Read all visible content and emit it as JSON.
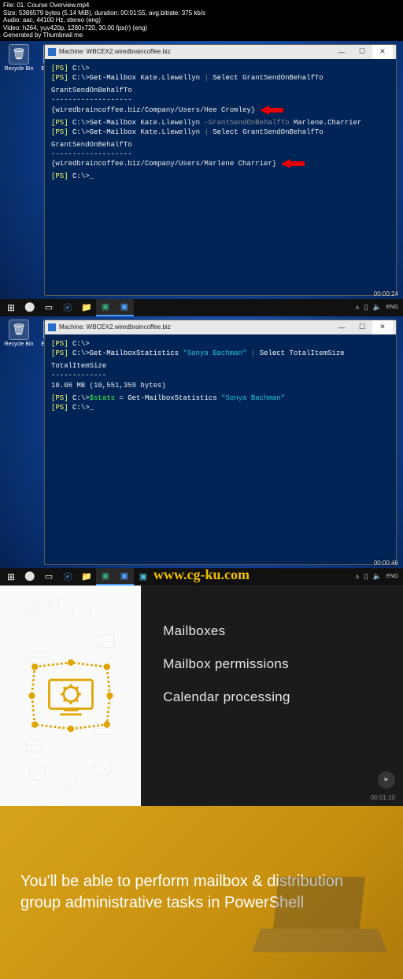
{
  "meta": {
    "file": "File: 01. Course Overview.mp4",
    "size": "Size: 5386579 bytes (5.14 MiB), duration: 00:01:55, avg.bitrate: 375 kb/s",
    "audio": "Audio: aac, 44100 Hz, stereo (eng)",
    "video": "Video: h264, yuv420p, 1280x720, 30.00 fps(r) (eng)",
    "gen": "Generated by Thumbnail me"
  },
  "desktop": {
    "recycle": "Recycle Bin",
    "exchange": "Exchange"
  },
  "window": {
    "title": "Machine: WBCEX2.wiredbraincoffee.biz",
    "min": "—",
    "max": "☐",
    "close": "✕"
  },
  "term1": {
    "psLabel": "[PS]",
    "prompt": "C:\\>",
    "cursor": "_",
    "l1a": "Get-Mailbox ",
    "l1b": "Kate.Llewellyn ",
    "l1c": "| ",
    "l1d": "Select ",
    "l1e": "GrantSendOnBehalfTo",
    "head": "GrantSendOnBehalfTo",
    "under": "-------------------",
    "out1": "{wiredbraincoffee.biz/Company/Users/Hee Cromley}",
    "l2a": "Set-Mailbox ",
    "l2b": "Kate.Llewellyn ",
    "l2c": "-GrantSendOnBehalfTo ",
    "l2d": "Marlene.Charrier",
    "out2": "{wiredbraincoffee.biz/Company/Users/Marlene Charrier}"
  },
  "term2": {
    "psLabel": "[PS]",
    "prompt": "C:\\>",
    "cursor": "_",
    "l1a": "Get-MailboxStatistics ",
    "l1b": "\"Sonya Bachman\" ",
    "l1c": "| ",
    "l1d": "Select ",
    "l1e": "TotalItemSize",
    "head": "TotalItemSize",
    "under": "-------------",
    "out1": "10.06 MB (10,551,359 bytes)",
    "l2a": "$stats",
    "l2b": " = ",
    "l2c": "Get-MailboxStatistics ",
    "l2d": "\"Sonya Bachman\""
  },
  "taskbar": {
    "time1": "",
    "ts1": "00:00:24",
    "ts2": "00:00:46",
    "lang": "ENG"
  },
  "watermark": "www.cg-ku.com",
  "slide3": {
    "items": [
      "Mailboxes",
      "Mailbox permissions",
      "Calendar processing"
    ],
    "ts": "00:01:10"
  },
  "slide4": {
    "text": "You'll be able to perform mailbox & distribution group administrative tasks in PowerShell"
  }
}
